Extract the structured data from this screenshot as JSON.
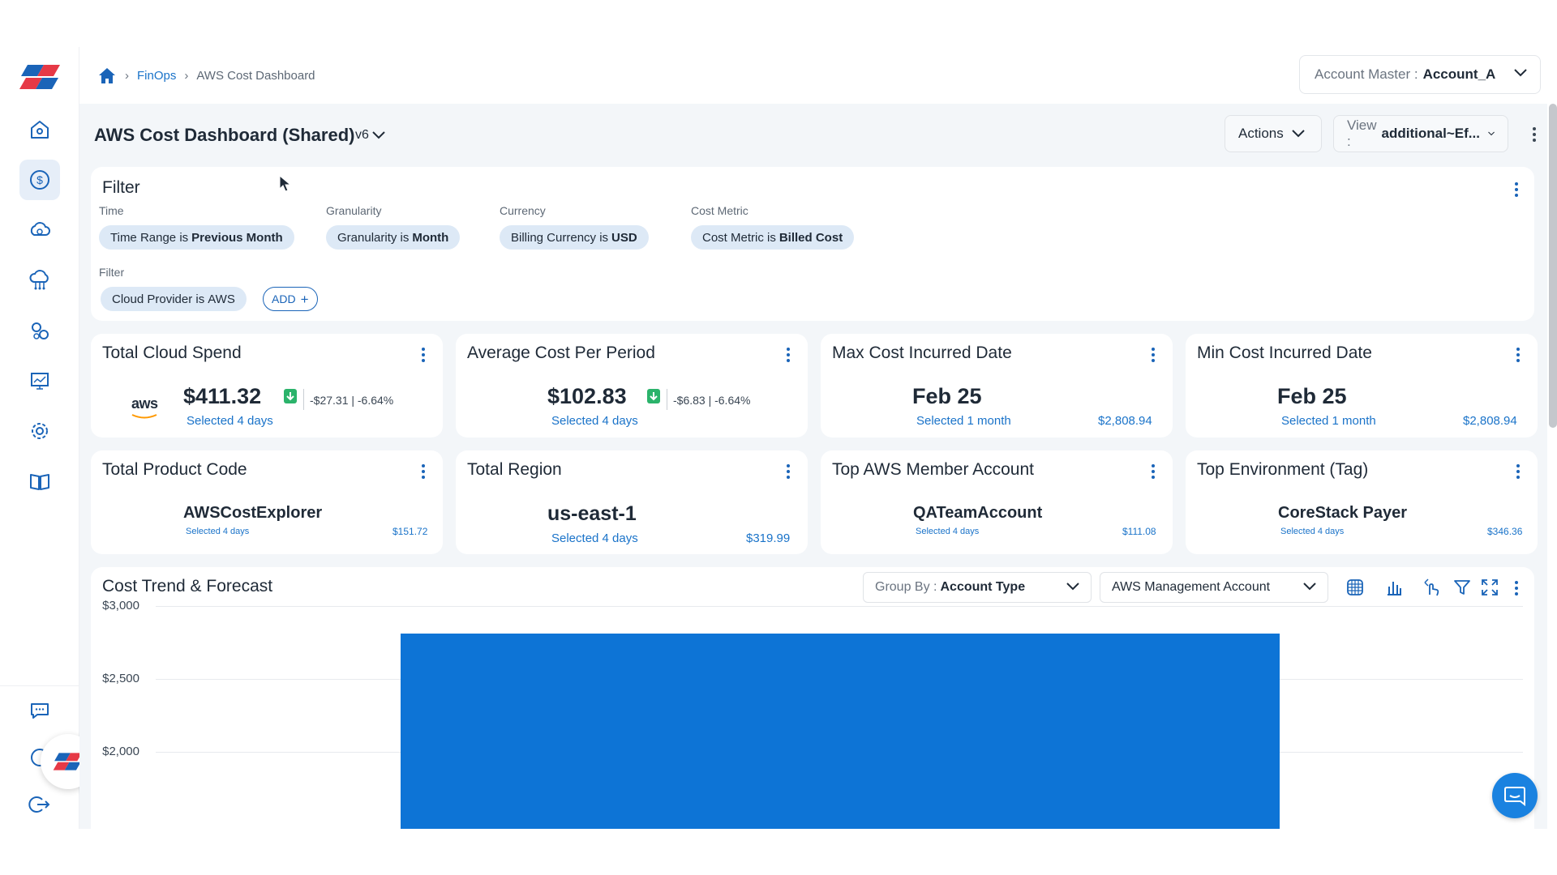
{
  "colors": {
    "accent": "#1a73c9",
    "bar": "#0d74d6",
    "chip_bg": "#dde9f6",
    "page_bg": "#f3f6f9",
    "down_green": "#2bb36b"
  },
  "sidebar": {
    "items": [
      {
        "icon": "home-icon",
        "active": false
      },
      {
        "icon": "dollar-circle-icon",
        "active": true
      },
      {
        "icon": "cloud-dollar-icon",
        "active": false
      },
      {
        "icon": "cloud-network-icon",
        "active": false
      },
      {
        "icon": "gears-icon",
        "active": false
      },
      {
        "icon": "presentation-chart-icon",
        "active": false
      },
      {
        "icon": "settings-icon",
        "active": false
      },
      {
        "icon": "book-icon",
        "active": false
      }
    ],
    "bottom_items": [
      {
        "icon": "chat-icon"
      },
      {
        "icon": "user-support-icon"
      },
      {
        "icon": "logout-icon"
      }
    ]
  },
  "breadcrumb": {
    "home_icon": "home-icon",
    "items": [
      "FinOps",
      "AWS Cost Dashboard"
    ]
  },
  "account_selector": {
    "label": "Account Master :",
    "value": "Account_A"
  },
  "dashboard": {
    "title": "AWS Cost Dashboard (Shared)",
    "version": "v6",
    "actions_label": "Actions",
    "view_label": "View :",
    "view_value": "additional~Ef..."
  },
  "filter": {
    "title": "Filter",
    "groups": [
      {
        "label": "Time",
        "chip_prefix": "Time Range is",
        "chip_value": "Previous Month"
      },
      {
        "label": "Granularity",
        "chip_prefix": "Granularity is",
        "chip_value": "Month"
      },
      {
        "label": "Currency",
        "chip_prefix": "Billing Currency is",
        "chip_value": "USD"
      },
      {
        "label": "Cost Metric",
        "chip_prefix": "Cost Metric is",
        "chip_value": "Billed Cost"
      }
    ],
    "filter_label": "Filter",
    "filter_chip_prefix": "Cloud Provider is",
    "filter_chip_value": "AWS",
    "add_label": "ADD"
  },
  "kpis": [
    {
      "title": "Total Cloud Spend",
      "logo": "aws",
      "value": "$411.32",
      "delta": "-$27.31 | -6.64%",
      "sub": "Selected 4 days"
    },
    {
      "title": "Average Cost Per Period",
      "value": "$102.83",
      "delta": "-$6.83 | -6.64%",
      "sub": "Selected 4 days"
    },
    {
      "title": "Max Cost Incurred Date",
      "value": "Feb 25",
      "sub": "Selected 1 month",
      "right": "$2,808.94"
    },
    {
      "title": "Min Cost Incurred Date",
      "value": "Feb 25",
      "sub": "Selected 1 month",
      "right": "$2,808.94"
    },
    {
      "title": "Total Product Code",
      "value": "AWSCostExplorer",
      "sub": "Selected 4 days",
      "right": "$151.72"
    },
    {
      "title": "Total Region",
      "value": "us-east-1",
      "sub": "Selected 4 days",
      "right": "$319.99"
    },
    {
      "title": "Top AWS Member Account",
      "value": "QATeamAccount",
      "sub": "Selected 4 days",
      "right": "$111.08"
    },
    {
      "title": "Top Environment (Tag)",
      "value": "CoreStack Payer",
      "sub": "Selected 4 days",
      "right": "$346.36"
    }
  ],
  "trend": {
    "title": "Cost Trend & Forecast",
    "group_by_label": "Group By :",
    "group_by_value": "Account Type",
    "account_filter": "AWS Management Account",
    "tools": [
      "globe-grid-icon",
      "bar-chart-icon",
      "drill-down-icon",
      "filter-icon",
      "expand-icon"
    ]
  },
  "chart_data": {
    "type": "bar",
    "ylim": [
      1500,
      3000
    ],
    "ytick_labels": [
      "$3,000",
      "$2,500",
      "$2,000"
    ],
    "ytick_values": [
      3000,
      2500,
      2000
    ],
    "series": [
      {
        "values": [
          2808.94
        ]
      }
    ],
    "categories": []
  }
}
